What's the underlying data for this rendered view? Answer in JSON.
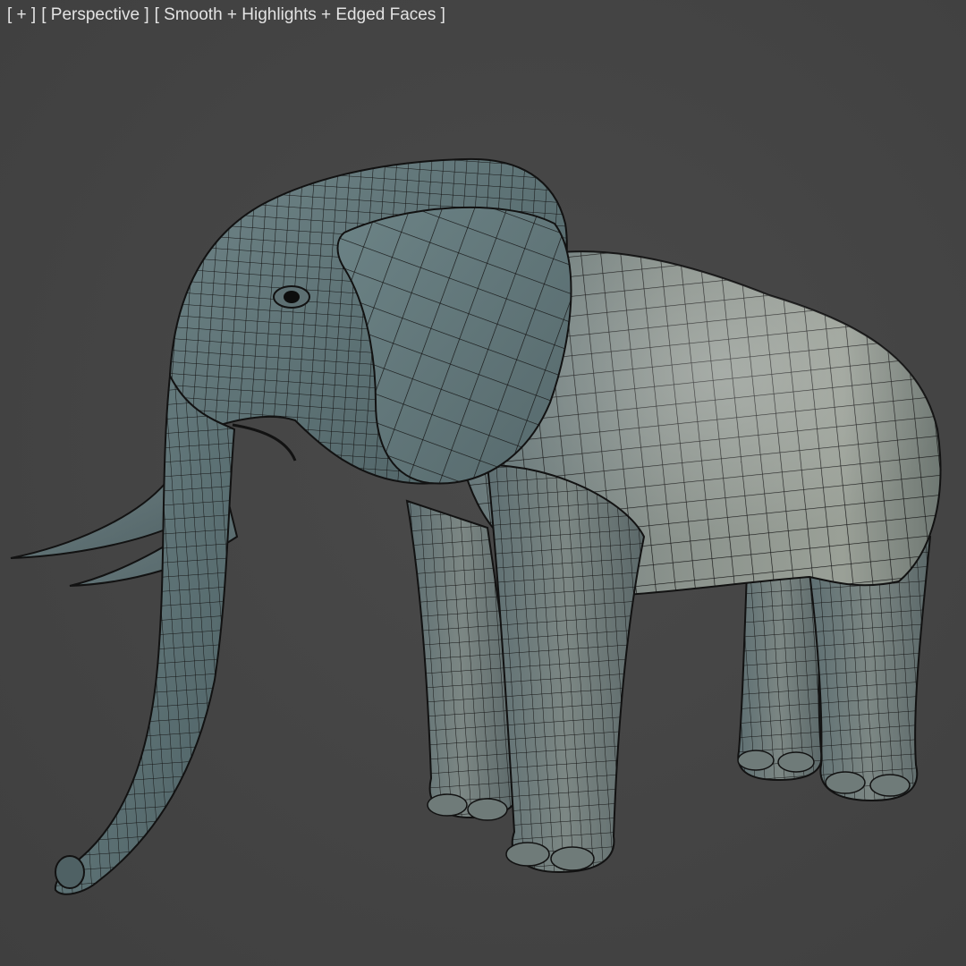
{
  "viewport": {
    "label_plus": "[ + ]",
    "label_view": "[ Perspective ]",
    "label_shading": "[ Smooth + Highlights + Edged Faces ]",
    "background_color": "#454545",
    "mesh_edge_color": "#111111",
    "model_color": "#7f8b87"
  },
  "model": {
    "subject": "elephant-mesh"
  }
}
